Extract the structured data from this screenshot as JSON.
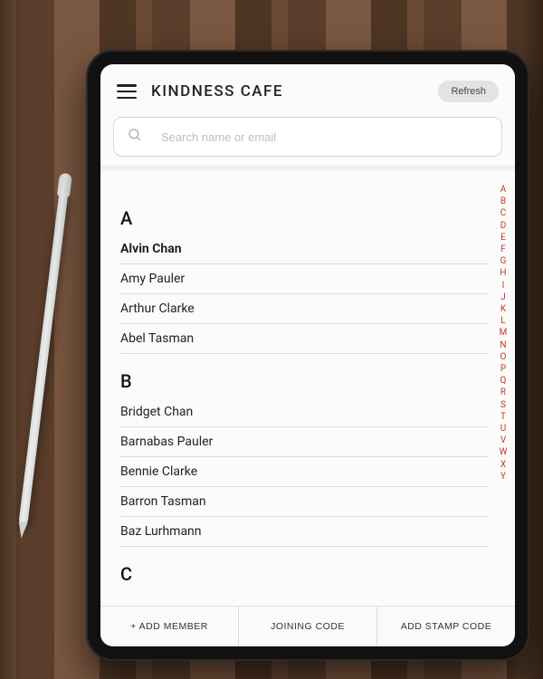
{
  "header": {
    "app_title": "KINDNESS CAFE",
    "refresh_label": "Refresh"
  },
  "search": {
    "placeholder": "Search name or email",
    "value": ""
  },
  "sections": [
    {
      "letter": "A",
      "rows": [
        {
          "name": "Alvin Chan",
          "selected": true
        },
        {
          "name": "Amy Pauler",
          "selected": false
        },
        {
          "name": "Arthur Clarke",
          "selected": false
        },
        {
          "name": "Abel Tasman",
          "selected": false
        }
      ]
    },
    {
      "letter": "B",
      "rows": [
        {
          "name": "Bridget Chan",
          "selected": false
        },
        {
          "name": "Barnabas Pauler",
          "selected": false
        },
        {
          "name": "Bennie Clarke",
          "selected": false
        },
        {
          "name": "Barron Tasman",
          "selected": false
        },
        {
          "name": "Baz Lurhmann",
          "selected": false
        }
      ]
    },
    {
      "letter": "C",
      "rows": []
    }
  ],
  "alpha_index": [
    "A",
    "B",
    "C",
    "D",
    "E",
    "F",
    "G",
    "H",
    "I",
    "J",
    "K",
    "L",
    "M",
    "N",
    "O",
    "P",
    "Q",
    "R",
    "S",
    "T",
    "U",
    "V",
    "W",
    "X",
    "Y"
  ],
  "colors": {
    "index_color": "#c0392b"
  },
  "bottom": {
    "add_member": "+ ADD MEMBER",
    "joining_code": "JOINING CODE",
    "add_stamp_code": "ADD STAMP CODE"
  }
}
